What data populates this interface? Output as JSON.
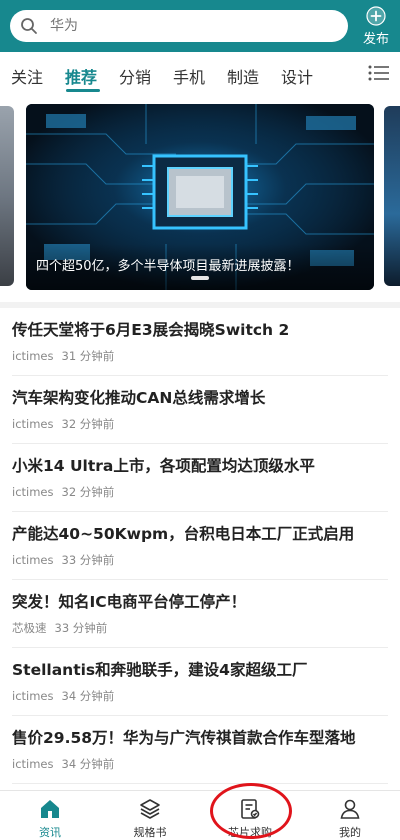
{
  "search": {
    "placeholder": "华为"
  },
  "header": {
    "publish_label": "发布"
  },
  "tabs": [
    {
      "label": "关注"
    },
    {
      "label": "推荐"
    },
    {
      "label": "分销"
    },
    {
      "label": "手机"
    },
    {
      "label": "制造"
    },
    {
      "label": "设计"
    }
  ],
  "carousel": {
    "caption": "四个超50亿，多个半导体项目最新进展披露！"
  },
  "news": [
    {
      "title": "传任天堂将于6月E3展会揭晓Switch 2",
      "source": "ictimes",
      "time": "31 分钟前"
    },
    {
      "title": "汽车架构变化推动CAN总线需求增长",
      "source": "ictimes",
      "time": "32 分钟前"
    },
    {
      "title": "小米14 Ultra上市，各项配置均达顶级水平",
      "source": "ictimes",
      "time": "32 分钟前"
    },
    {
      "title": "产能达40~50Kwpm，台积电日本工厂正式启用",
      "source": "ictimes",
      "time": "33 分钟前"
    },
    {
      "title": "突发！知名IC电商平台停工停产！",
      "source": "芯极速",
      "time": "33 分钟前"
    },
    {
      "title": "Stellantis和奔驰联手，建设4家超级工厂",
      "source": "ictimes",
      "time": "34 分钟前"
    },
    {
      "title": "售价29.58万！华为与广汽传祺首款合作车型落地",
      "source": "ictimes",
      "time": "34 分钟前"
    }
  ],
  "bottom_nav": [
    {
      "label": "资讯",
      "icon": "home-icon"
    },
    {
      "label": "规格书",
      "icon": "layers-icon"
    },
    {
      "label": "芯片求购",
      "icon": "document-icon"
    },
    {
      "label": "我的",
      "icon": "user-icon"
    }
  ],
  "colors": {
    "brand": "#17888e",
    "highlight": "#e0141b"
  }
}
